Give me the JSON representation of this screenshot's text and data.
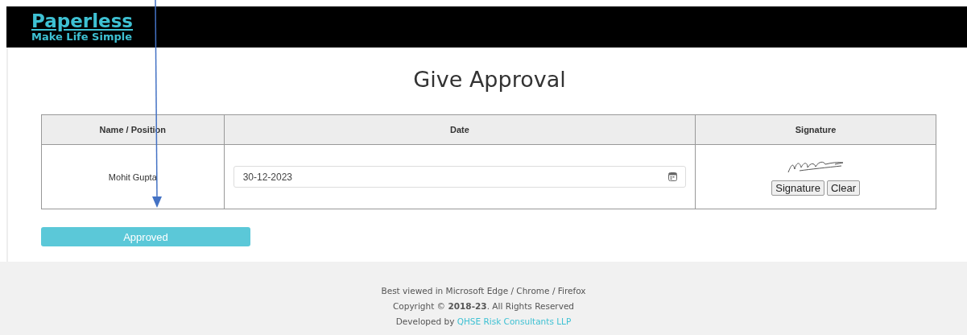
{
  "header": {
    "logo_title": "Paperless",
    "logo_tagline": "Make Life Simple"
  },
  "page_title": "Give Approval",
  "table": {
    "columns": [
      "Name / Position",
      "Date",
      "Signature"
    ],
    "rows": [
      {
        "name": "Mohit Gupta",
        "date": "30-12-2023",
        "signature_buttons": [
          "Signature",
          "Clear"
        ]
      }
    ]
  },
  "approve_button": "Approved",
  "footer": {
    "browser_note": "Best viewed in Microsoft Edge / Chrome / Firefox",
    "copyright": "Copyright © **2018-23**. All Rights Reserved",
    "developed_by": {
      "text": "Developed by",
      "link": "QHSE Risk Consultants LLP"
    }
  }
}
